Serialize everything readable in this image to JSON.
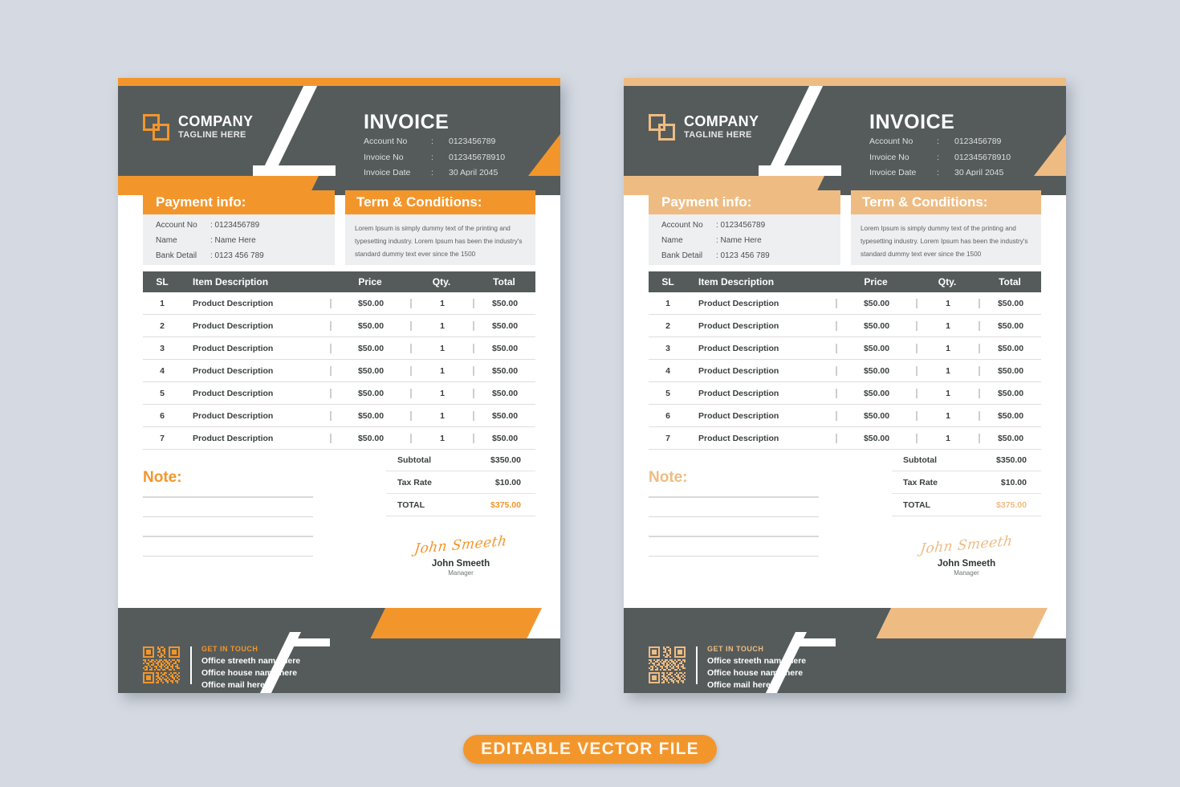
{
  "theme": {
    "left_accent": "#f2962c",
    "right_accent": "#eebc83",
    "dark": "#555b5b",
    "panel_bg": "#eeeff0",
    "page_bg": "#d5dae2"
  },
  "banner": {
    "label": "EDITABLE VECTOR  FILE"
  },
  "invoice": {
    "brand": {
      "company": "COMPANY",
      "tagline": "TAGLINE HERE",
      "logo_icon": "overlapping-squares-logo-icon"
    },
    "title": "INVOICE",
    "meta": [
      {
        "key": "Account No",
        "sep": ":",
        "value": "0123456789"
      },
      {
        "key": "Invoice No",
        "sep": ":",
        "value": "012345678910"
      },
      {
        "key": "Invoice Date",
        "sep": ":",
        "value": "30 April 2045"
      }
    ],
    "payment": {
      "heading": "Payment info:",
      "rows": [
        {
          "key": "Account No",
          "value": ": 0123456789"
        },
        {
          "key": "Name",
          "value": ": Name Here"
        },
        {
          "key": "Bank Detail",
          "value": ": 0123 456 789"
        }
      ]
    },
    "terms": {
      "heading": "Term & Conditions:",
      "body": "Lorem Ipsum is simply dummy text of the printing and typesetting industry. Lorem Ipsum has been the industry's standard dummy text ever since the 1500"
    },
    "table": {
      "columns": [
        "SL",
        "Item Description",
        "Price",
        "Qty.",
        "Total"
      ],
      "rows": [
        {
          "sl": "1",
          "desc": "Product Description",
          "price": "$50.00",
          "qty": "1",
          "total": "$50.00"
        },
        {
          "sl": "2",
          "desc": "Product Description",
          "price": "$50.00",
          "qty": "1",
          "total": "$50.00"
        },
        {
          "sl": "3",
          "desc": "Product Description",
          "price": "$50.00",
          "qty": "1",
          "total": "$50.00"
        },
        {
          "sl": "4",
          "desc": "Product Description",
          "price": "$50.00",
          "qty": "1",
          "total": "$50.00"
        },
        {
          "sl": "5",
          "desc": "Product Description",
          "price": "$50.00",
          "qty": "1",
          "total": "$50.00"
        },
        {
          "sl": "6",
          "desc": "Product Description",
          "price": "$50.00",
          "qty": "1",
          "total": "$50.00"
        },
        {
          "sl": "7",
          "desc": "Product Description",
          "price": "$50.00",
          "qty": "1",
          "total": "$50.00"
        }
      ]
    },
    "note": {
      "heading": "Note:",
      "line_count": 4
    },
    "totals": [
      {
        "key": "Subtotal",
        "value": "$350.00",
        "accent": false
      },
      {
        "key": "Tax Rate",
        "value": "$10.00",
        "accent": false
      },
      {
        "key": "TOTAL",
        "value": "$375.00",
        "accent": true
      }
    ],
    "signature": {
      "mark": "John Smeeth",
      "name": "John Smeeth",
      "role": "Manager"
    },
    "footer": {
      "qr_icon": "qr-code-icon",
      "heading": "GET IN TOUCH",
      "lines": [
        "Office streeth name here",
        "Office house name here",
        "Office mail here"
      ]
    }
  }
}
